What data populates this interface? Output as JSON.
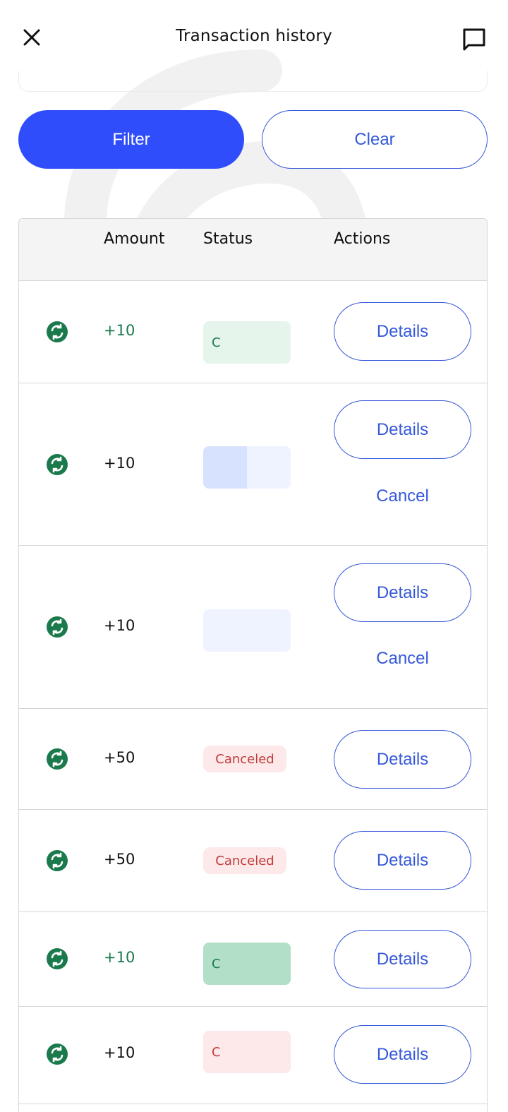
{
  "header": {
    "title": "Transaction history",
    "close_icon": "close-icon",
    "chat_icon": "chat-icon"
  },
  "actions": {
    "filter_label": "Filter",
    "clear_label": "Clear"
  },
  "table": {
    "columns": [
      "",
      "Amount",
      "Status",
      "Actions"
    ],
    "rows": [
      {
        "icon": "exchange-icon",
        "amount": "+10",
        "status": "C",
        "details_label": "Details",
        "cancel_label": ""
      },
      {
        "icon": "exchange-icon",
        "amount": "+10",
        "status": "",
        "details_label": "Details",
        "cancel_label": "Cancel"
      },
      {
        "icon": "exchange-icon",
        "amount": "+10",
        "status": "",
        "details_label": "Details",
        "cancel_label": "Cancel"
      },
      {
        "icon": "exchange-icon",
        "amount": "+50",
        "status": "Canceled",
        "details_label": "Details",
        "cancel_label": ""
      },
      {
        "icon": "exchange-icon",
        "amount": "+50",
        "status": "Canceled",
        "details_label": "Details",
        "cancel_label": ""
      },
      {
        "icon": "exchange-icon",
        "amount": "+10",
        "status": "C",
        "details_label": "Details",
        "cancel_label": ""
      },
      {
        "icon": "exchange-icon",
        "amount": "+10",
        "status": "C",
        "details_label": "Details",
        "cancel_label": ""
      }
    ]
  },
  "colors": {
    "primary": "#2f4dfb",
    "link": "#3558d9",
    "success": "#1a7a4c",
    "danger": "#c23b3b"
  }
}
